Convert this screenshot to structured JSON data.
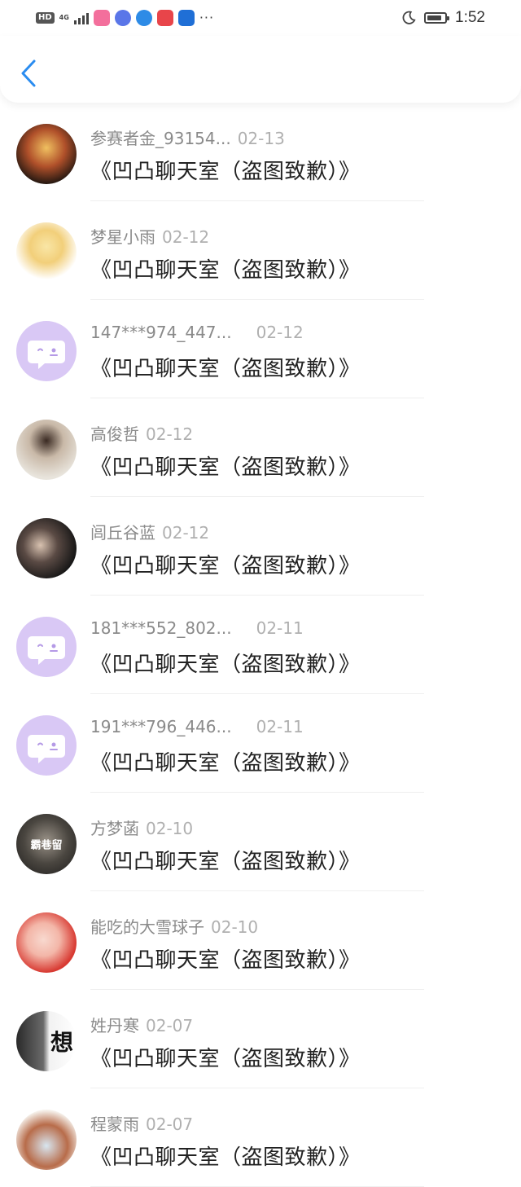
{
  "status_bar": {
    "hd": "HD",
    "network": "4G",
    "time": "1:52",
    "battery_level": 0.85,
    "app_icons": [
      "bilibili-icon",
      "music-icon",
      "browser-icon",
      "huawei-icon",
      "lightbulb-icon"
    ],
    "more": "···"
  },
  "header": {
    "back_icon": "back-chevron-icon",
    "accent": "#2a8cf0"
  },
  "message_text": "《凹凸聊天室（盗图致歉）》",
  "rows": [
    {
      "name": "参赛者金_93154...",
      "date": "02-13",
      "avatar": "photo"
    },
    {
      "name": "梦星小雨",
      "date": "02-12",
      "avatar": "photo"
    },
    {
      "name": "147***974_447...",
      "date": "02-12",
      "avatar": "default"
    },
    {
      "name": "高俊哲",
      "date": "02-12",
      "avatar": "photo"
    },
    {
      "name": "闾丘谷蓝",
      "date": "02-12",
      "avatar": "photo"
    },
    {
      "name": "181***552_802...",
      "date": "02-11",
      "avatar": "default"
    },
    {
      "name": "191***796_446...",
      "date": "02-11",
      "avatar": "default"
    },
    {
      "name": "方梦菡",
      "date": "02-10",
      "avatar": "photo",
      "avatar_text": "霸巷留"
    },
    {
      "name": "能吃的大雪球子",
      "date": "02-10",
      "avatar": "photo"
    },
    {
      "name": "姓丹寒",
      "date": "02-07",
      "avatar": "photo",
      "avatar_text": "想"
    },
    {
      "name": "程蒙雨",
      "date": "02-07",
      "avatar": "photo"
    }
  ]
}
